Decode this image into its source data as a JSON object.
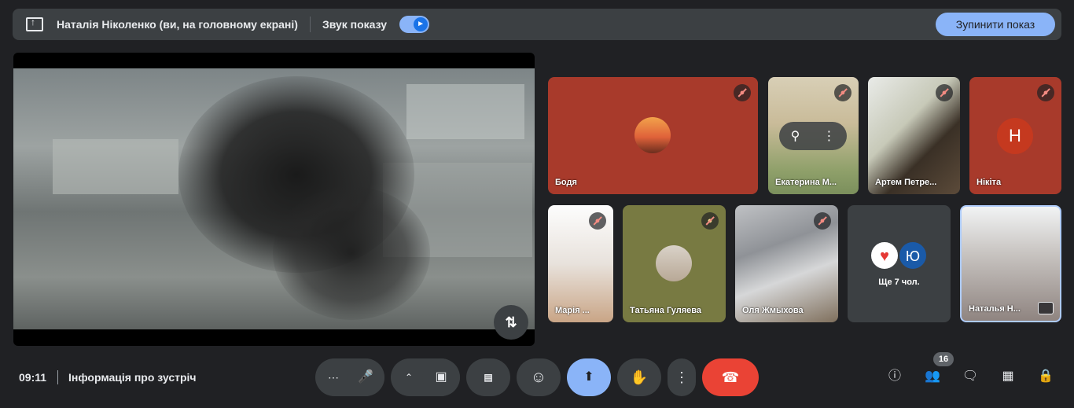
{
  "top_bar": {
    "presenter_label": "Наталія Ніколенко (ви, на головному екрані)",
    "sound_label": "Звук показу",
    "sound_on": true,
    "stop_label": "Зупинити показ"
  },
  "participants": [
    {
      "name": "Бодя",
      "muted": true
    },
    {
      "name": "Екатерина М...",
      "muted": true
    },
    {
      "name": "Артем Петре...",
      "muted": true
    },
    {
      "name": "Нікіта",
      "muted": true,
      "initial": "Н"
    },
    {
      "name": "Марія ...",
      "muted": true
    },
    {
      "name": "Татьяна Гуляева",
      "muted": true
    },
    {
      "name": "Оля Жмыхова",
      "muted": true
    },
    {
      "name": "Наталья Н...",
      "muted": false
    }
  ],
  "overflow_tile": {
    "initial": "Ю",
    "label": "Ще 7 чол."
  },
  "bottom_bar": {
    "time": "09:11",
    "meeting_info": "Інформація про зустріч",
    "people_count": "16"
  },
  "colors": {
    "accent": "#8ab4f8",
    "end_call": "#ea4335",
    "tile_red": "#a83a2b"
  }
}
